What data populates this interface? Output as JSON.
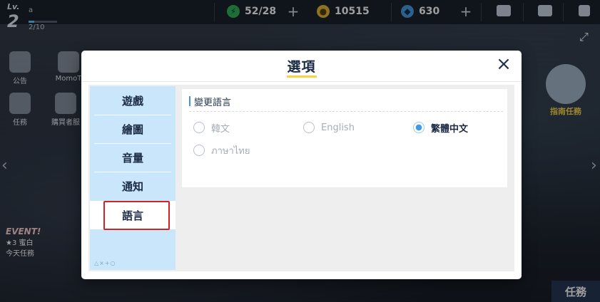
{
  "hud": {
    "level_label": "Lv.",
    "level_value": "2",
    "player_name": "a",
    "exp_text": "2/10",
    "exp_progress": 0.2,
    "ap": "52/28",
    "gold": "10515",
    "gems": "630"
  },
  "background": {
    "side_left_top": "公告",
    "side_left_momo": "MomoT",
    "side_left_task": "任務",
    "side_left_shop": "購買者服",
    "event_title": "EVENT!",
    "event_sub": "★3 蜜白",
    "event_tag": "今天任務",
    "guide_label": "指南任務",
    "quest_label": "任務"
  },
  "modal": {
    "title": "選項",
    "close_symbol": "×",
    "tabs": [
      {
        "label": "遊戲"
      },
      {
        "label": "繪圖"
      },
      {
        "label": "音量"
      },
      {
        "label": "通知"
      },
      {
        "label": "語言"
      }
    ],
    "active_tab": "語言",
    "tabs_footer": "△×+○",
    "section_title": "變更語言",
    "languages": [
      {
        "label": "韓文",
        "selected": false
      },
      {
        "label": "English",
        "selected": false
      },
      {
        "label": "繁體中文",
        "selected": true
      },
      {
        "label": "ภาษาไทย",
        "selected": false
      }
    ]
  },
  "colors": {
    "accent_underline": "#f5d545",
    "tab_bg": "#c9e6fb",
    "radio_selected": "#3f9be6",
    "highlight_border": "#d62121"
  }
}
